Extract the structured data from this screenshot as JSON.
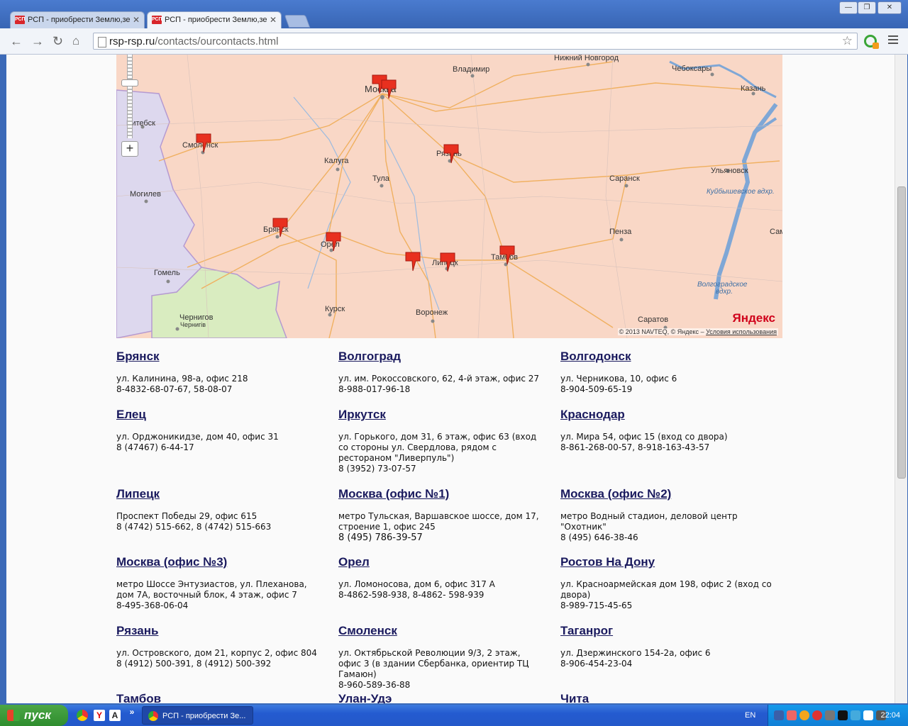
{
  "browser": {
    "tabs": [
      {
        "title": "РСП - приобрести Землю,зе",
        "favicon": "РСП"
      },
      {
        "title": "РСП - приобрести Землю,зе",
        "favicon": "РСП"
      }
    ],
    "url_host": "rsp-rsp.ru",
    "url_path": "/contacts/ourcontacts.html",
    "window_buttons": [
      "—",
      "❐",
      "✕"
    ]
  },
  "map": {
    "copyright": "© 2013 NAVTEQ, © Яндекс –",
    "terms_link": "Условия использования",
    "logo": "Яндекс",
    "cities": [
      {
        "name": "Нижний Новгород",
        "kind": "city"
      },
      {
        "name": "Чебоксары",
        "kind": "city"
      },
      {
        "name": "Владимир",
        "kind": "city"
      },
      {
        "name": "Казань",
        "kind": "city"
      },
      {
        "name": "Москва",
        "kind": "city"
      },
      {
        "name": "Витебск",
        "kind": "city"
      },
      {
        "name": "Смоленск",
        "kind": "city"
      },
      {
        "name": "Калуга",
        "kind": "city"
      },
      {
        "name": "Рязань",
        "kind": "city"
      },
      {
        "name": "Тула",
        "kind": "city"
      },
      {
        "name": "Саранск",
        "kind": "city"
      },
      {
        "name": "Ульяновск",
        "kind": "city"
      },
      {
        "name": "Могилев",
        "kind": "city"
      },
      {
        "name": "Брянск",
        "kind": "city"
      },
      {
        "name": "Орел",
        "kind": "city"
      },
      {
        "name": "Пенза",
        "kind": "city"
      },
      {
        "name": "Липецк",
        "kind": "city"
      },
      {
        "name": "Тамбов",
        "kind": "city"
      },
      {
        "name": "Гомель",
        "kind": "city"
      },
      {
        "name": "Курск",
        "kind": "city"
      },
      {
        "name": "Воронеж",
        "kind": "city"
      },
      {
        "name": "Чернигов",
        "kind": "city"
      },
      {
        "name": "Чернигів",
        "kind": "city"
      },
      {
        "name": "Саратов",
        "kind": "city"
      },
      {
        "name": "Сам",
        "kind": "city"
      }
    ],
    "water": [
      "Куйбышевское вдхр.",
      "Волгоградское",
      "вдхр."
    ]
  },
  "offices": [
    {
      "city": "Брянск",
      "address": "ул. Калинина, 98-а, офис 218",
      "phone": "8-4832-68-07-67, 58-08-07"
    },
    {
      "city": "Волгоград",
      "address": "ул. им. Рокоссовского, 62, 4-й этаж, офис 27",
      "phone": "8-988-017-96-18"
    },
    {
      "city": "Волгодонск",
      "address": "ул. Черникова, 10, офис 6",
      "phone": "8-904-509-65-19"
    },
    {
      "city": "Елец",
      "address": "ул. Орджоникидзе, дом 40, офис 31",
      "phone": "8 (47467) 6-44-17"
    },
    {
      "city": "Иркутск",
      "address": "ул. Горького, дом 31, 6 этаж, офис 63 (вход со стороны ул. Свердлова, рядом с рестораном \"Ливерпуль\")",
      "phone": "8 (3952) 73-07-57"
    },
    {
      "city": "Краснодар",
      "address": "ул. Мира 54, офис 15 (вход со двора)",
      "phone": "8-861-268-00-57, 8-918-163-43-57"
    },
    {
      "city": "Липецк",
      "address": "Проспект Победы 29, офис 615",
      "phone": "8 (4742) 515-662, 8 (4742) 515-663"
    },
    {
      "city": "Москва (офис №1)",
      "address": "метро Тульская, Варшавское шоссе, дом 17, строение 1, офис 245",
      "phone": "8 (495) 786-39-57"
    },
    {
      "city": "Москва (офис №2)",
      "address": "метро Водный стадион, деловой центр \"Охотник\"",
      "phone": "8 (495) 646-38-46"
    },
    {
      "city": "Москва (офис №3)",
      "address": "метро Шоссе Энтузиастов, ул. Плеханова, дом 7А, восточный блок, 4 этаж, офис 7",
      "phone": "8-495-368-06-04"
    },
    {
      "city": "Орел",
      "address": "ул. Ломоносова, дом 6, офис 317 А",
      "phone": "8-4862-598-938, 8-4862- 598-939"
    },
    {
      "city": "Ростов На Дону",
      "address": "ул. Красноармейская дом 198, офис 2 (вход со двора)",
      "phone": "8-989-715-45-65"
    },
    {
      "city": "Рязань",
      "address": "ул. Островского, дом 21, корпус 2, офис 804",
      "phone": "8 (4912) 500-391, 8 (4912) 500-392"
    },
    {
      "city": "Смоленск",
      "address": "ул. Октябрьской Революции 9/3, 2 этаж, офис 3 (в здании Сбербанка, ориентир ТЦ Гамаюн)",
      "phone": "8-960-589-36-88"
    },
    {
      "city": "Таганрог",
      "address": "ул. Дзержинского 154-2а, офис 6",
      "phone": "8-906-454-23-04"
    },
    {
      "city": "Тамбов",
      "address": "",
      "phone": ""
    },
    {
      "city": "Улан-Удэ",
      "address": "",
      "phone": ""
    },
    {
      "city": "Чита",
      "address": "",
      "phone": ""
    }
  ],
  "taskbar": {
    "start": "пуск",
    "window_title": "РСП - приобрести Зе...",
    "lang": "EN",
    "clock": "22:04",
    "quicklaunch_more": "»"
  }
}
